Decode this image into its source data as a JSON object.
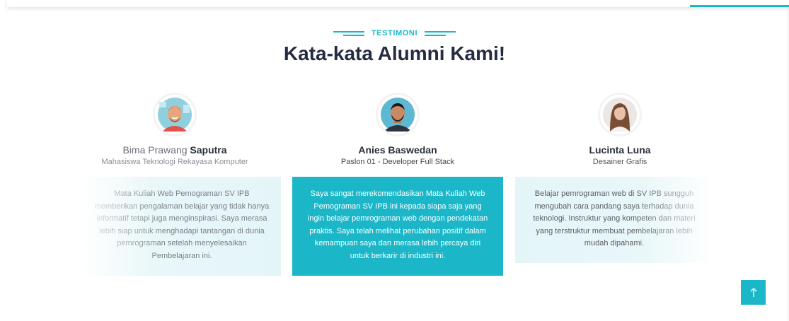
{
  "section": {
    "label": "TESTIMONI",
    "title": "Kata-kata Alumni Kami!"
  },
  "testimonials": [
    {
      "first_name": "Bima Prawang",
      "last_name": "Saputra",
      "role": "Mahasiswa Teknologi Rekayasa Komputer",
      "text": "Mata Kuliah Web Pemograman SV IPB memberikan pengalaman belajar yang tidak hanya informatif tetapi juga menginspirasi. Saya merasa lebih siap untuk menghadapi tantangan di dunia pemrograman setelah menyelesaikan Pembelajaran ini."
    },
    {
      "first_name": "Anies",
      "last_name": "Baswedan",
      "role": "Paslon 01 - Developer Full Stack",
      "text": "Saya sangat merekomendasikan Mata Kuliah Web Pemograman SV IPB ini kepada siapa saja yang ingin belajar pemrograman web dengan pendekatan praktis. Saya telah melihat perubahan positif dalam kemampuan saya dan merasa lebih percaya diri untuk berkarir di industri ini."
    },
    {
      "first_name": "Lucinta",
      "last_name": "Luna",
      "role": "Desainer Grafis",
      "text": "Belajar pemrograman web di SV IPB sungguh mengubah cara pandang saya terhadap dunia teknologi. Instruktur yang kompeten dan materi yang terstruktur membuat pembelajaran lebih mudah dipahami."
    }
  ],
  "scroll_top": {
    "icon": "arrow-up-icon"
  },
  "colors": {
    "accent": "#1bb7c9",
    "heading": "#252b42"
  }
}
